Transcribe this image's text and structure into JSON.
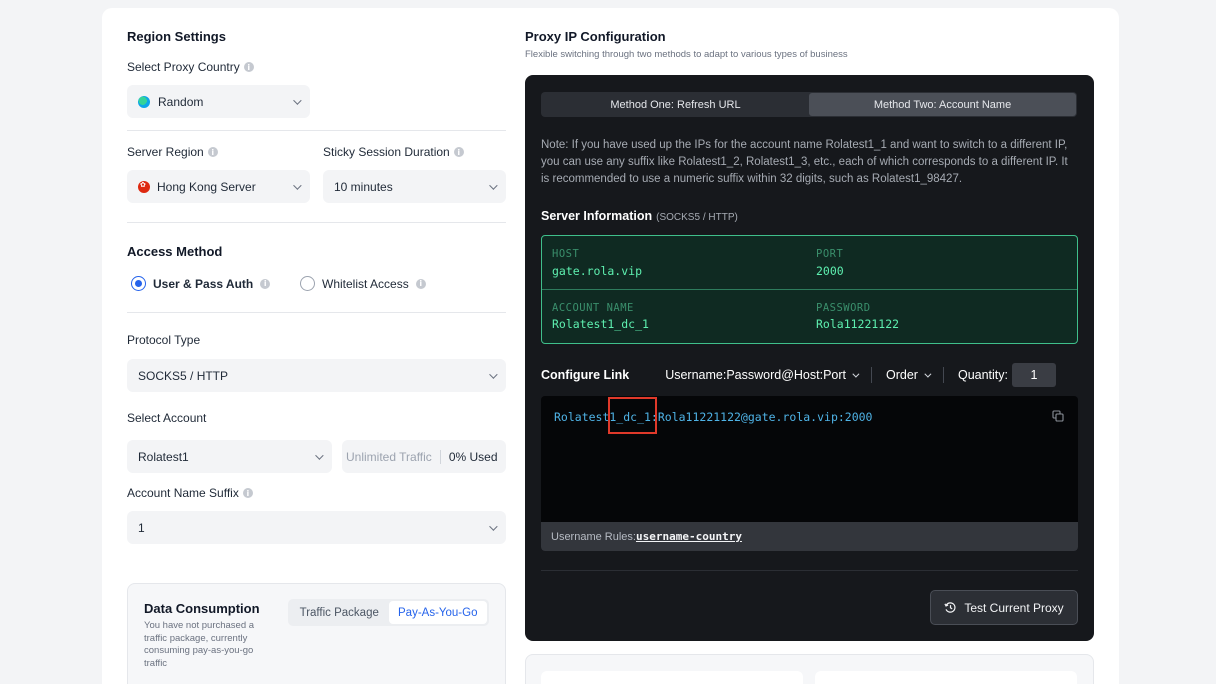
{
  "region": {
    "title": "Region Settings",
    "country_label": "Select Proxy Country",
    "country_value": "Random",
    "server_region_label": "Server Region",
    "server_region_value": "Hong Kong Server",
    "sticky_label": "Sticky Session Duration",
    "sticky_value": "10 minutes"
  },
  "access": {
    "title": "Access Method",
    "options": [
      {
        "label": "User & Pass Auth",
        "selected": true
      },
      {
        "label": "Whitelist Access",
        "selected": false
      }
    ]
  },
  "protocol": {
    "label": "Protocol Type",
    "value": "SOCKS5 / HTTP"
  },
  "account": {
    "label": "Select Account",
    "value": "Rolatest1",
    "traffic_label": "Unlimited Traffic",
    "used": "0% Used",
    "suffix_label": "Account Name Suffix",
    "suffix_value": "1"
  },
  "consumption": {
    "title": "Data Consumption",
    "description": "You have not purchased a traffic package, currently consuming pay-as-you-go traffic",
    "tabs": [
      "Traffic Package",
      "Pay-As-You-Go"
    ],
    "active_tab": "Pay-As-You-Go"
  },
  "proxy": {
    "title": "Proxy IP Configuration",
    "subtitle": "Flexible switching through two methods to adapt to various types of business",
    "tabs": [
      "Method One: Refresh URL",
      "Method Two: Account Name"
    ],
    "active_tab": "Method Two: Account Name",
    "note": "Note: If you have used up the IPs for the account name Rolatest1_1 and want to switch to a different IP, you can use any suffix like Rolatest1_2, Rolatest1_3, etc., each of which corresponds to a different IP. It is recommended to use a numeric suffix within 32 digits, such as Rolatest1_98427.",
    "server_info_title": "Server Information",
    "server_info_sub": "(SOCKS5 / HTTP)",
    "host_key": "HOST",
    "host": "gate.rola.vip",
    "port_key": "PORT",
    "port": "2000",
    "account_key": "ACCOUNT NAME",
    "account_name": "Rolatest1_dc_1",
    "password_key": "PASSWORD",
    "password": "Rola11221122",
    "configure_title": "Configure Link",
    "format": "Username:Password@Host:Port",
    "order": "Order",
    "quantity_label": "Quantity:",
    "quantity": "1",
    "link": "Rolatest1_dc_1:Rola11221122@gate.rola.vip:2000",
    "rules_label": "Username Rules:",
    "rules_value": "username-country",
    "test_button": "Test Current Proxy"
  },
  "colors": {
    "accent": "#2563eb",
    "server_green": "#5ef0b0",
    "link_blue": "#4fb3e6",
    "highlight": "#e0392a"
  }
}
